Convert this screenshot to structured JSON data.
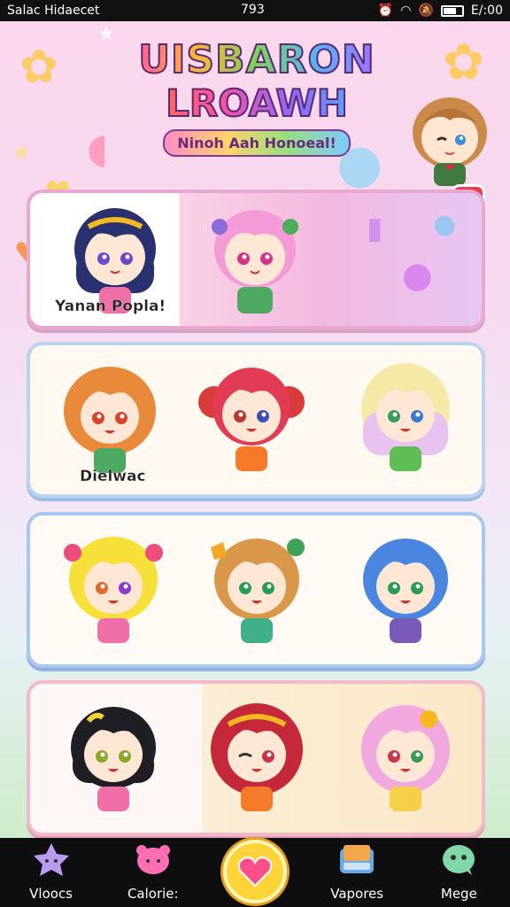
{
  "status_bar": {
    "left_text": "Salac Hidaecet",
    "center_text": "793",
    "time": "E/:00"
  },
  "header": {
    "title_line1": "UISBARON",
    "title_line2": "LROAWH",
    "subtitle": "Ninoh Aah Honoeal!"
  },
  "panels": [
    {
      "label": "Yanan Popla!",
      "characters": [
        "navy-hair-girl",
        "pink-hair-girl"
      ]
    },
    {
      "label": "Dielwac",
      "characters": [
        "orange-hair-girl",
        "red-hair-girl",
        "blonde-hair-girl"
      ]
    },
    {
      "label": "",
      "characters": [
        "yellow-hair-girl",
        "brown-hair-girl",
        "blue-hair-girl"
      ]
    },
    {
      "label": "",
      "characters": [
        "black-hair-girl",
        "crimson-hair-girl",
        "lilac-hair-girl"
      ]
    }
  ],
  "close_label": "✕",
  "nav": {
    "items": [
      {
        "label": "Vloocs",
        "icon": "star-creature-icon"
      },
      {
        "label": "Calorie:",
        "icon": "pink-blob-icon"
      },
      {
        "label": "",
        "icon": "heart-icon"
      },
      {
        "label": "Vapores",
        "icon": "book-icon"
      },
      {
        "label": "Mege",
        "icon": "chat-creature-icon"
      }
    ]
  },
  "colors": {
    "accent_pink": "#ff5aa5",
    "close_red": "#ea3d4e",
    "nav_bg": "#0e0e10",
    "heart_yellow": "#ffd43b"
  }
}
